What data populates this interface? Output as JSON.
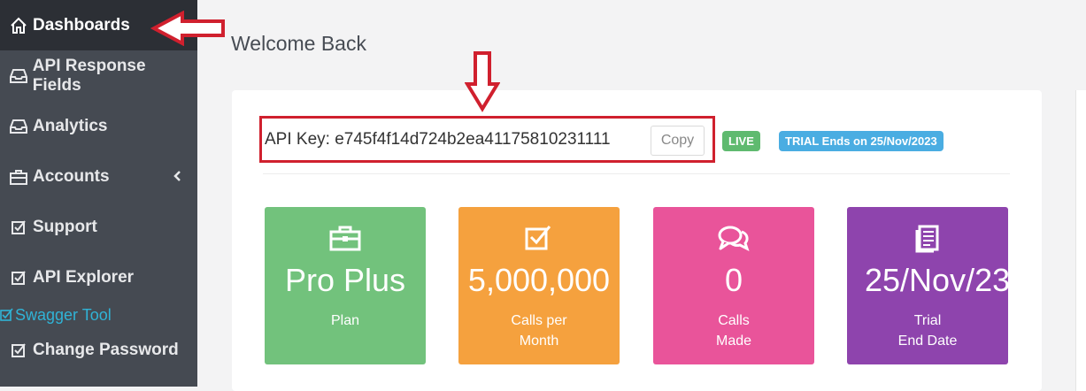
{
  "sidebar": {
    "items": [
      {
        "label": "Dashboards",
        "icon": "home-icon",
        "active": true
      },
      {
        "label": "API Response Fields",
        "icon": "inbox-icon"
      },
      {
        "label": "Analytics",
        "icon": "inbox-icon"
      },
      {
        "label": "Accounts",
        "icon": "briefcase-icon"
      },
      {
        "label": "Support",
        "icon": "check-square-icon"
      },
      {
        "label": "API Explorer",
        "icon": "check-square-icon"
      },
      {
        "label": "Change Password",
        "icon": "check-square-icon"
      }
    ],
    "sub_item": {
      "label": "Swagger Tool",
      "icon": "check-square-icon"
    }
  },
  "main": {
    "title": "Welcome Back",
    "api_key_label": "API Key: e745f4f14d724b2ea41175810231111",
    "copy_label": "Copy",
    "live_badge": "LIVE",
    "trial_badge": "TRIAL Ends on 25/Nov/2023",
    "cards": [
      {
        "value": "Pro Plus",
        "label": "Plan",
        "icon": "briefcase-icon",
        "color": "#72c27c"
      },
      {
        "value": "5,000,000",
        "label": "Calls per\nMonth",
        "icon": "check-square-icon",
        "color": "#f5a13e"
      },
      {
        "value": "0",
        "label": "Calls\nMade",
        "icon": "chat-icon",
        "color": "#e9549a"
      },
      {
        "value": "25/Nov/23",
        "label": "Trial\nEnd Date",
        "icon": "document-icon",
        "color": "#8e44ad"
      }
    ]
  },
  "colors": {
    "sidebar_bg": "#454a52",
    "sidebar_active": "#2c2f35",
    "accent_link": "#30b3d6",
    "annotation_red": "#d0202e"
  }
}
